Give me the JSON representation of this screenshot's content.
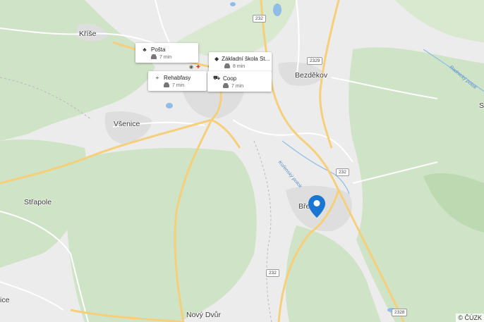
{
  "map": {
    "colors": {
      "background": "#ececec",
      "forest": "#cfe3c6",
      "forest_dark": "#bcd9b1",
      "road_major": "#f6cf7a",
      "road_minor": "#ffffff",
      "water": "#8fbde8",
      "built": "#dedede",
      "pin": "#1976d2"
    },
    "places": [
      {
        "name": "Kříše"
      },
      {
        "name": "Všenice"
      },
      {
        "name": "Střapole"
      },
      {
        "name": "Bezděkov"
      },
      {
        "name": "Nový Dvůr"
      },
      {
        "name": "Bře"
      },
      {
        "name": "ice"
      },
      {
        "name": "S"
      }
    ],
    "water_labels": [
      "Kořenský potok",
      "Radnický potok"
    ],
    "road_shields": [
      "232",
      "2329",
      "232",
      "232",
      "2328"
    ],
    "pois": [
      {
        "label": "Pošta",
        "icon": "post-icon",
        "glyph": "♣",
        "time": "7 min"
      },
      {
        "label": "Základní škola St...",
        "icon": "school-icon",
        "glyph": "◆",
        "time": "8 min"
      },
      {
        "label": "Rehabfasy",
        "icon": "medical-cross-icon",
        "glyph": "+",
        "time": "7 min"
      },
      {
        "label": "Coop",
        "icon": "shopping-cart-icon",
        "glyph": "⛟",
        "time": "7 min"
      }
    ],
    "travel_mode_icon": "car-icon",
    "location_pin_icon": "map-pin-icon",
    "attribution": "© ČÚZK"
  }
}
